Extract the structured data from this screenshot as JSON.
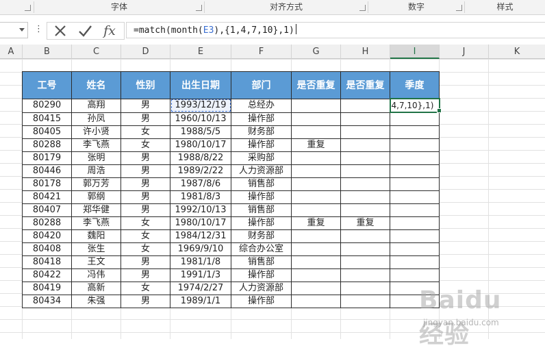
{
  "ribbon": {
    "groups": [
      "字体",
      "对齐方式",
      "数字",
      "样式"
    ]
  },
  "formula_bar": {
    "name_box": "",
    "cancel_icon": "x-icon",
    "enter_icon": "check-icon",
    "function_label": "fx",
    "formula_pre": "=match(month(",
    "formula_ref": "E3",
    "formula_post": "),{1,4,7,10},1)"
  },
  "grid": {
    "column_headers": [
      "A",
      "B",
      "C",
      "D",
      "E",
      "F",
      "G",
      "H",
      "I",
      "J",
      "K"
    ],
    "active_column": "I"
  },
  "table": {
    "headers": [
      "工号",
      "姓名",
      "性别",
      "出生日期",
      "部门",
      "是否重复",
      "是否重复",
      "季度"
    ],
    "rows": [
      [
        "80290",
        "高翔",
        "男",
        "1993/12/19",
        "总经办",
        "",
        "",
        "4,7,10},1)"
      ],
      [
        "80415",
        "孙凤",
        "男",
        "1960/10/13",
        "操作部",
        "",
        "",
        ""
      ],
      [
        "80405",
        "许小贤",
        "女",
        "1988/5/5",
        "财务部",
        "",
        "",
        ""
      ],
      [
        "80288",
        "李飞燕",
        "女",
        "1980/10/17",
        "操作部",
        "重复",
        "",
        ""
      ],
      [
        "80179",
        "张明",
        "男",
        "1988/8/22",
        "采购部",
        "",
        "",
        ""
      ],
      [
        "80446",
        "周浩",
        "男",
        "1989/2/22",
        "人力资源部",
        "",
        "",
        ""
      ],
      [
        "80178",
        "郭万芳",
        "男",
        "1987/8/6",
        "销售部",
        "",
        "",
        ""
      ],
      [
        "80421",
        "郭纲",
        "男",
        "1981/8/3",
        "操作部",
        "",
        "",
        ""
      ],
      [
        "80407",
        "郑华健",
        "男",
        "1992/10/13",
        "销售部",
        "",
        "",
        ""
      ],
      [
        "80288",
        "李飞燕",
        "女",
        "1980/10/17",
        "操作部",
        "重复",
        "重复",
        ""
      ],
      [
        "80420",
        "魏阳",
        "女",
        "1984/12/31",
        "财务部",
        "",
        "",
        ""
      ],
      [
        "80408",
        "张生",
        "女",
        "1969/9/10",
        "综合办公室",
        "",
        "",
        ""
      ],
      [
        "80418",
        "王文",
        "男",
        "1981/1/8",
        "销售部",
        "",
        "",
        ""
      ],
      [
        "80422",
        "冯伟",
        "男",
        "1991/1/3",
        "操作部",
        "",
        "",
        ""
      ],
      [
        "80419",
        "高新",
        "女",
        "1974/2/27",
        "人力资源部",
        "",
        "",
        ""
      ],
      [
        "80434",
        "朱强",
        "男",
        "1989/1/1",
        "操作部",
        "",
        "",
        ""
      ]
    ]
  },
  "watermark": {
    "logo": "Baidu 经验",
    "sub": "jingyan.baidu.com"
  },
  "colors": {
    "header_fill": "#5b9bd5",
    "selection_green": "#217346",
    "reference_blue": "#3b6fd1"
  }
}
